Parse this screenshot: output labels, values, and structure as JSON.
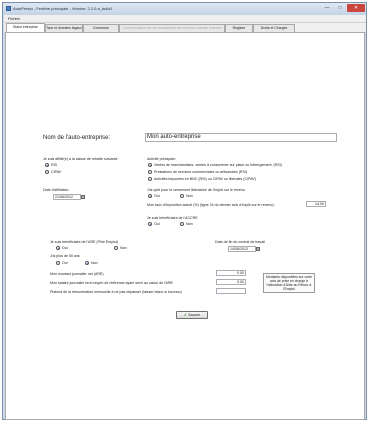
{
  "window": {
    "title": "AutoPresto - Fenêtre principale  -  Version: 2.2.0.a_build1",
    "min": "—",
    "max": "□",
    "close": "✕"
  },
  "menu": {
    "fichier": "Fichier"
  },
  "tabs": [
    {
      "label": "Statut entreprise",
      "active": true
    },
    {
      "label": "Taux et données légaux"
    },
    {
      "label": "Connexion"
    },
    {
      "label": "Communication par les mandataires de fonctions d'accès indirects",
      "disabled": true
    },
    {
      "label": "Registre"
    },
    {
      "label": "Droits et Charges"
    }
  ],
  "form": {
    "company_name_label": "Nom de l'auto-entreprise:",
    "company_name_value": "Mon auto-entreprise",
    "retirement_label": "Je suis affilié(e) à la caisse de retraite suivante:",
    "retirement_options": [
      "RSI",
      "CIPAV"
    ],
    "activity_label": "Activité principale:",
    "activity_options": [
      "Ventes de marchandises, ventes à consommer sur place ou hébergement. (RSI)",
      "Prestations de services commerciales ou artisanales (RSI)",
      "Activités imposées en BNC (RSI) ou CIPAV ou libérales (CIPAV)"
    ],
    "affiliation_label": "Date d'affiliation:",
    "affiliation_date": "21/06/2012",
    "liberatoire_label": "J'ai opté pour le versement libératoire de l'impôt sur le revenu",
    "yes": "Oui",
    "no": "Non",
    "tax_rate_label": "Mon taux d'imposition actuel (%) (ligne 24 du dernier avis d'impôt sur le revenu):",
    "tax_rate_value": "14.00",
    "accre_label": "Je suis bénéficiaire de l'ACCRE",
    "are_label": "Je suis bénéficiaire de l'ARE (Pôle Emploi)",
    "contract_end_label": "Date de fin du contrat de travail",
    "contract_end_date": "14/06/2012",
    "age50_label": "J'ai plus de 50 ans",
    "are_amount_label": "Mon montant journalier net (ARE)",
    "are_amount_value": "0.00",
    "salary_label": "Mon salaire journalier brut moyen de référence ayant servi au calcul de l'ARE",
    "salary_value": "0.00",
    "ceiling_label": "Plafond de la rémunération mensuelle à ne pas dépasser (laisser blanc si inconnu)",
    "ceiling_value": "",
    "note": "Montants disponibles sur votre avis de prise en charge à l'allocation d'Aide au Retour à l'Emploi",
    "save": "Sauver"
  }
}
